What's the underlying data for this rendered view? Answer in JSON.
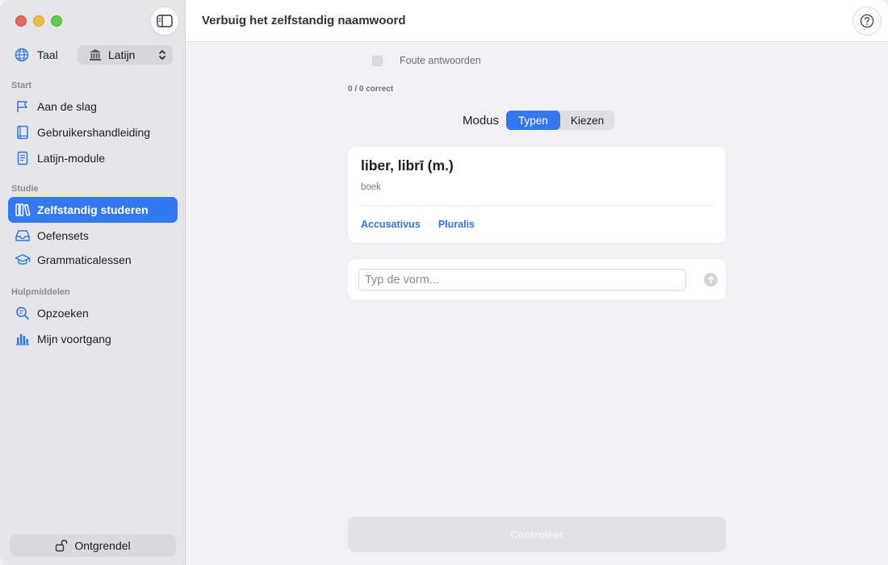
{
  "header": {
    "title": "Verbuig het zelfstandig naamwoord"
  },
  "sidebar": {
    "language_label": "Taal",
    "language_value": "Latijn",
    "sections": {
      "start": "Start",
      "study": "Studie",
      "tools": "Hulpmiddelen"
    },
    "items": [
      {
        "label": "Aan de slag",
        "icon": "flag-icon"
      },
      {
        "label": "Gebruikershandleiding",
        "icon": "book-icon"
      },
      {
        "label": "Latijn-module",
        "icon": "document-icon"
      },
      {
        "label": "Zelfstandig studeren",
        "icon": "books-icon",
        "active": true
      },
      {
        "label": "Oefensets",
        "icon": "tray-icon"
      },
      {
        "label": "Grammaticalessen",
        "icon": "graduation-cap-icon"
      },
      {
        "label": "Opzoeken",
        "icon": "search-icon"
      },
      {
        "label": "Mijn voortgang",
        "icon": "bar-chart-icon"
      }
    ],
    "unlock_label": "Ontgrendel"
  },
  "main": {
    "wrong_answers_label": "Foute antwoorden",
    "wrong_answers_checked": false,
    "score": "0 / 0 correct",
    "mode_label": "Modus",
    "modes": [
      "Typen",
      "Kiezen"
    ],
    "active_mode": "Typen",
    "card": {
      "word": "liber, librī (m.)",
      "meaning": "boek",
      "case": "Accusativus",
      "number": "Pluralis",
      "separator": "·"
    },
    "input_placeholder": "Typ de vorm...",
    "check_label": "Controleer"
  },
  "colors": {
    "accent": "#3478f0",
    "link": "#2f74e3",
    "sidebar_bg": "#e6e6ea",
    "content_bg": "#f1f1f5"
  }
}
